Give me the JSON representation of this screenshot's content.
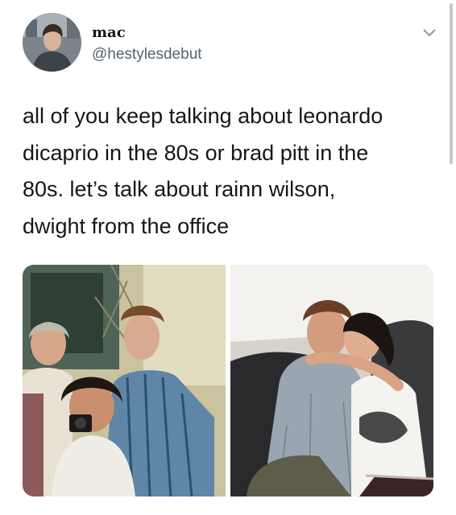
{
  "tweet": {
    "display_name": "mac",
    "handle": "@hestylesdebut",
    "text_lines": [
      "all of you keep talking about leonardo",
      "dicaprio in the 80s or brad pitt in the",
      "80s. let’s talk about rainn wilson,",
      "dwight from the office"
    ]
  },
  "icons": {
    "avatar": "profile-photo",
    "menu": "chevron-down-icon"
  },
  "colors": {
    "text": "#14171a",
    "secondary_text": "#536471",
    "background": "#ffffff"
  }
}
